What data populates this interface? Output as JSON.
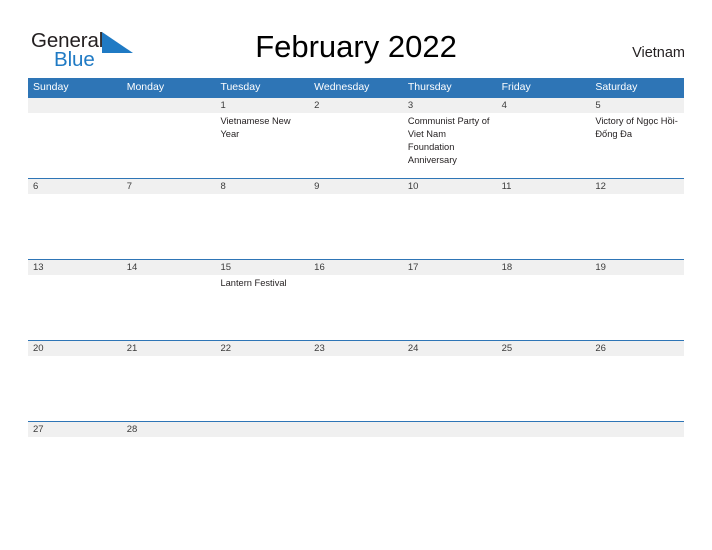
{
  "brand": {
    "name_part1": "General",
    "name_part2": "Blue",
    "flag_icon": "triangle-flag-icon",
    "color_dark": "#231f20",
    "color_blue": "#1f7ac4"
  },
  "header": {
    "title": "February 2022",
    "country": "Vietnam"
  },
  "theme": {
    "header_blue": "#2e75b6",
    "date_band_gray": "#f0f0f0",
    "text_dark": "#231f20"
  },
  "calendar": {
    "weekdays": [
      "Sunday",
      "Monday",
      "Tuesday",
      "Wednesday",
      "Thursday",
      "Friday",
      "Saturday"
    ],
    "weeks": [
      {
        "days": [
          {
            "num": "",
            "event": ""
          },
          {
            "num": "",
            "event": ""
          },
          {
            "num": "1",
            "event": "Vietnamese New Year"
          },
          {
            "num": "2",
            "event": ""
          },
          {
            "num": "3",
            "event": "Communist Party of Viet Nam Foundation Anniversary"
          },
          {
            "num": "4",
            "event": ""
          },
          {
            "num": "5",
            "event": "Victory of Ngọc Hồi-Đống Đa"
          }
        ]
      },
      {
        "days": [
          {
            "num": "6",
            "event": ""
          },
          {
            "num": "7",
            "event": ""
          },
          {
            "num": "8",
            "event": ""
          },
          {
            "num": "9",
            "event": ""
          },
          {
            "num": "10",
            "event": ""
          },
          {
            "num": "11",
            "event": ""
          },
          {
            "num": "12",
            "event": ""
          }
        ]
      },
      {
        "days": [
          {
            "num": "13",
            "event": ""
          },
          {
            "num": "14",
            "event": ""
          },
          {
            "num": "15",
            "event": "Lantern Festival"
          },
          {
            "num": "16",
            "event": ""
          },
          {
            "num": "17",
            "event": ""
          },
          {
            "num": "18",
            "event": ""
          },
          {
            "num": "19",
            "event": ""
          }
        ]
      },
      {
        "days": [
          {
            "num": "20",
            "event": ""
          },
          {
            "num": "21",
            "event": ""
          },
          {
            "num": "22",
            "event": ""
          },
          {
            "num": "23",
            "event": ""
          },
          {
            "num": "24",
            "event": ""
          },
          {
            "num": "25",
            "event": ""
          },
          {
            "num": "26",
            "event": ""
          }
        ]
      },
      {
        "days": [
          {
            "num": "27",
            "event": ""
          },
          {
            "num": "28",
            "event": ""
          },
          {
            "num": "",
            "event": ""
          },
          {
            "num": "",
            "event": ""
          },
          {
            "num": "",
            "event": ""
          },
          {
            "num": "",
            "event": ""
          },
          {
            "num": "",
            "event": ""
          }
        ]
      }
    ]
  }
}
